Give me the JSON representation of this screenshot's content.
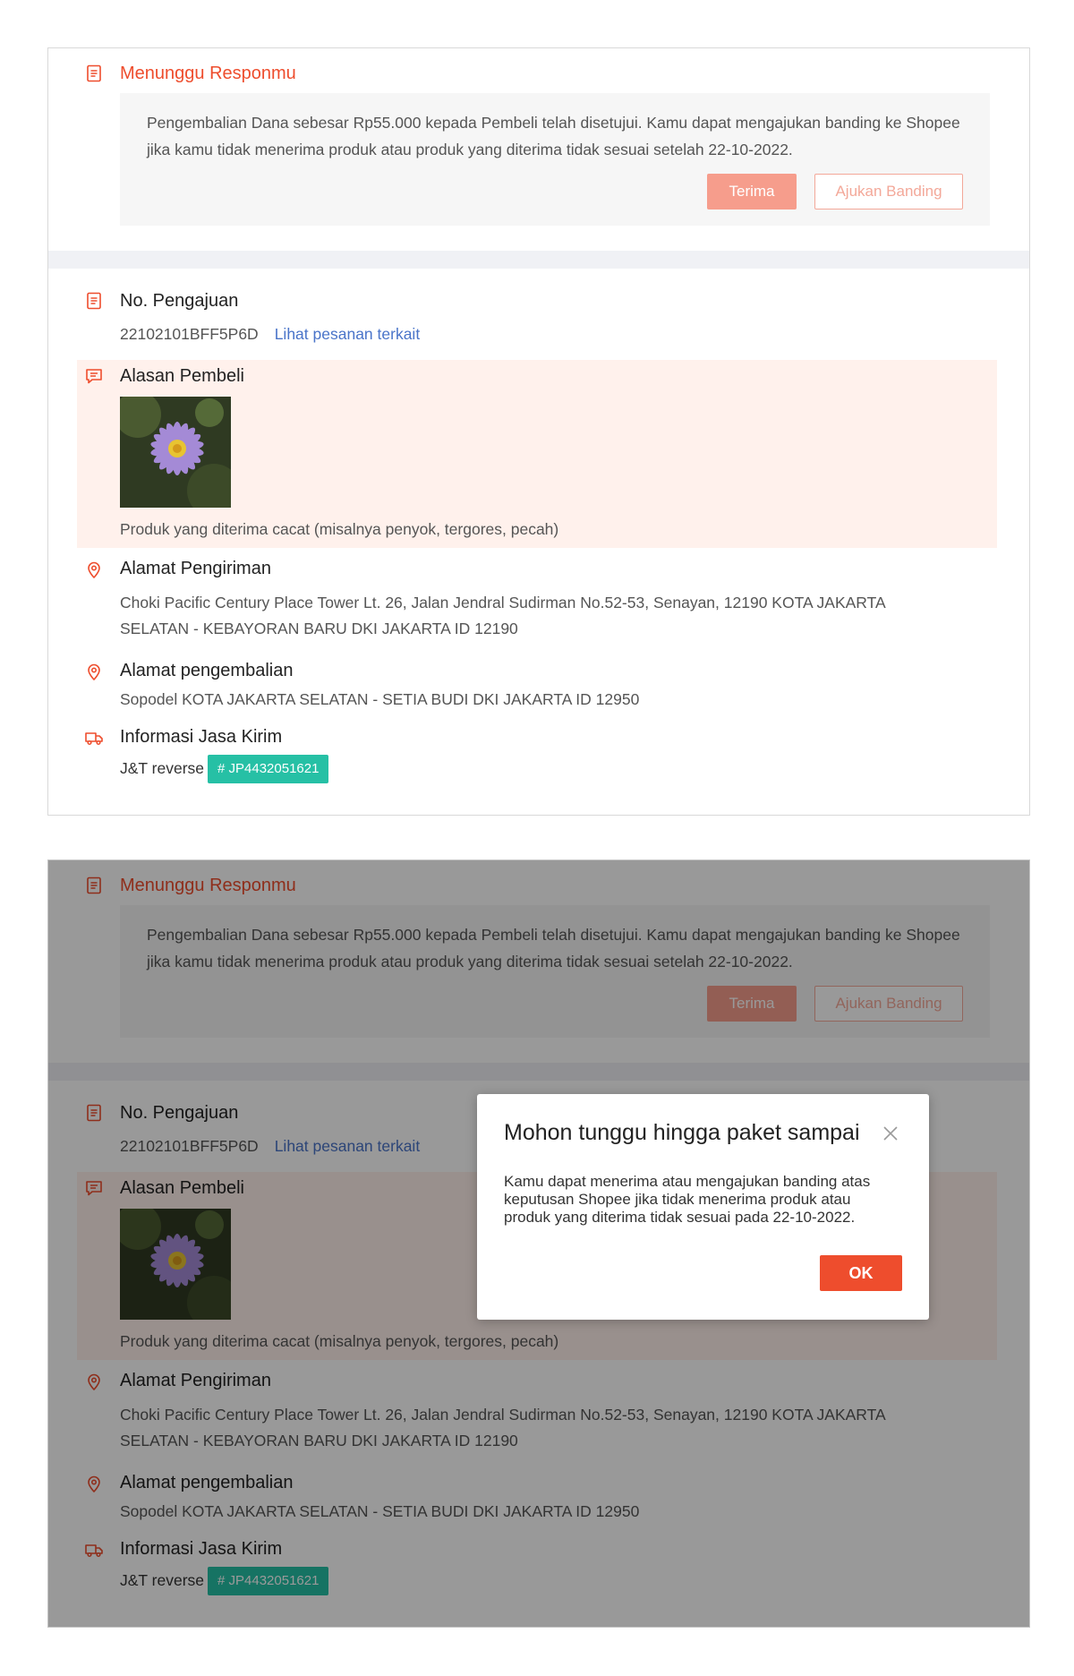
{
  "status": {
    "title": "Menunggu Responmu",
    "message": "Pengembalian Dana sebesar Rp55.000 kepada Pembeli telah disetujui. Kamu dapat mengajukan banding ke Shopee jika kamu tidak menerima produk atau produk yang diterima tidak sesuai setelah 22-10-2022.",
    "accept_label": "Terima",
    "appeal_label": "Ajukan Banding",
    "icon": "document-icon"
  },
  "request": {
    "title": "No. Pengajuan",
    "number": "22102101BFF5P6D",
    "link_label": "Lihat pesanan terkait",
    "icon": "document-icon"
  },
  "reason": {
    "title": "Alasan Pembeli",
    "text": "Produk yang diterima cacat (misalnya penyok, tergores, pecah)",
    "icon": "chat-icon"
  },
  "shipping_address": {
    "title": "Alamat Pengiriman",
    "line1": "Choki Pacific Century Place Tower Lt. 26, Jalan Jendral Sudirman No.52-53, Senayan, 12190 KOTA JAKARTA",
    "line2": "SELATAN - KEBAYORAN BARU DKI JAKARTA ID 12190",
    "icon": "location-pin-icon"
  },
  "return_address": {
    "title": "Alamat pengembalian",
    "text": "Sopodel KOTA JAKARTA SELATAN - SETIA BUDI DKI JAKARTA ID 12950",
    "icon": "location-pin-icon"
  },
  "courier": {
    "title": "Informasi Jasa Kirim",
    "carrier": "J&T reverse",
    "tracking": "# JP4432051621",
    "icon": "truck-icon"
  },
  "modal": {
    "title": "Mohon tunggu hingga paket sampai",
    "body": "Kamu dapat menerima atau mengajukan banding atas keputusan Shopee jika tidak menerima produk atau produk yang diterima tidak sesuai pada 22-10-2022.",
    "ok_label": "OK"
  },
  "colors": {
    "accent": "#ee4d2d",
    "accent_light": "#f69d8c",
    "link": "#4a74c9",
    "badge": "#26c0a5",
    "reason_bg": "#fff1ec"
  }
}
